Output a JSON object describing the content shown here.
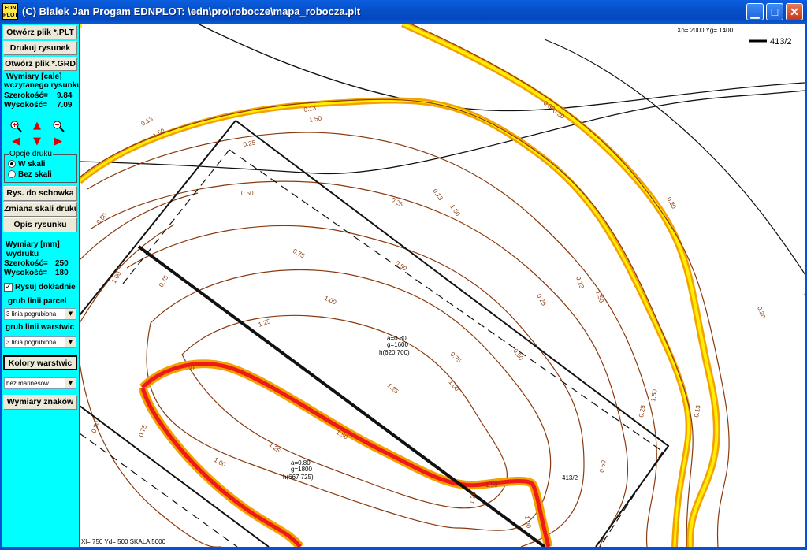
{
  "window": {
    "icon_text_top": "EDN",
    "icon_text_bottom": "PLOT",
    "title": "(C) Bialek Jan Progam EDNPLOT: \\edn\\pro\\robocze\\mapa_robocza.plt"
  },
  "sidebar": {
    "open_plt": "Otwórz plik *.PLT",
    "print": "Drukuj rysunek",
    "open_grd": "Otwórz plik *.GRD",
    "dims_title_1": "Wymiary [cale]",
    "dims_title_2": "wczytanego rysunku",
    "width_label": "Szerokość=",
    "width_value": "9.84",
    "height_label": "Wysokość=",
    "height_value": "7.09",
    "print_options": "Opcje druku",
    "scale_on": "W skali",
    "scale_off": "Bez skali",
    "clipboard": "Rys. do schowka",
    "change_scale": "Zmiana skali druku",
    "describe": "Opis rysunku",
    "mm_title_1": "Wymiary [mm]",
    "mm_title_2": "wydruku",
    "mm_width_label": "Szerokość=",
    "mm_width_value": "250",
    "mm_height_label": "Wysokość=",
    "mm_height_value": "180",
    "draw_exact": "Rysuj dokładnie",
    "parcel_line": "grub linii parcel",
    "parcel_select": "3 linia pogrubiona",
    "layer_line": "grub linii warstwic",
    "layer_select": "3 linia pogrubiona",
    "layer_colors": "Kolory warstwic",
    "color_select": "bez marinesow",
    "sign_dims": "Wymiary znaków"
  },
  "map": {
    "coord_top": "Xp=  2000 Yg=   1400",
    "legend_label": "413/2",
    "coord_bottom": "Xl=   750 Yd=   500    SKALA 5000",
    "annot1_a": "a=0.80",
    "annot1_g": "g=1600",
    "annot1_h": "h(620  700)",
    "annot2_a": "a=0.80",
    "annot2_g": "g=1800",
    "annot2_h": "h(667  725)",
    "parcel_label": "413/2",
    "contours": {
      "c013": "0.13",
      "c025": "0.25",
      "c050": "0.50",
      "c075": "0.75",
      "c100": "1.00",
      "c125": "1.25",
      "c150": "1.50",
      "c030": "0.30"
    }
  },
  "colors": {
    "contour": "#8b3a0e",
    "yellow": "#ffee00",
    "orange": "#f2a100",
    "red": "#ee1a1a",
    "sidebar": "#00ffff"
  }
}
